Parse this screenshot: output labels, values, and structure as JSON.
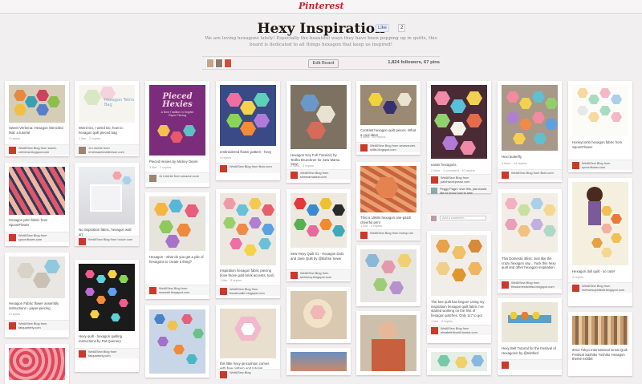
{
  "header": {
    "logo": "Pinterest"
  },
  "board": {
    "title": "Hexy Inspiration",
    "like": "Like",
    "like_count": "2",
    "description": "We are loving hexagons lately! Especially the beautiful ways they have been popping up in quilts, this board is dedicated to all things hexagon that keep us inspired!",
    "edit_label": "Edit Board",
    "stats": "1,824 followers, 67 pins"
  },
  "pins": [
    {
      "cap": "Sweet Verbena: Hexagon Stenciled Mat: a tutorial",
      "rp": "3 repins",
      "from": "WeAllSew Blog from sweet-verbena.blogspot.com"
    },
    {
      "cap": "Hexagon prim fabric from SpoonFlower",
      "rp": "",
      "from": "WeAllSew Blog from spoonflower.com"
    },
    {
      "cap": "Hexagon Fabric flower assembly instructions - paper-piecing",
      "rp": "3 repins",
      "from": "WeAllSew Blog from fatquarterly.com"
    },
    {
      "cap": "Weird Do, I weird Do; how to: hexagon quilt pieced bag",
      "rp": "1 like · 2 repins",
      "from": "Jo Leichte from reneesachmattenson.com"
    },
    {
      "cap": "No inspiration fabric, hexagon wall art",
      "rp": "",
      "from": "WeAllSew Blog from houzz.com"
    },
    {
      "cap": "Hexy quilt - hexagon quilting instructions by Pat Quenery",
      "rp": "",
      "from": "WeAllSew Blog from fatquarterly.com"
    },
    {
      "cap": "Pieced Hexies by Mickey Depre",
      "rp": "1 like · 2 repins",
      "from": "Jo Leichte from amazon.com"
    },
    {
      "cap": "Hexagon - what do you get a pile of hexagons to create a thing?",
      "rp": "",
      "from": "WeAllSew Blog from sewweb.blogspot.com"
    },
    {
      "cap": "embroidered flower pattern - hexy",
      "rp": "3 repins",
      "from": "WeAllSew Blog from flickr.com"
    },
    {
      "cap": "Inspiration hexagon fabric piecing (love those gold brick accents, too!)",
      "rp": "1 like · 3 repins",
      "from": "WeAllSew Blog from fionalmallie.blogspot.com"
    },
    {
      "cap": "this little hexy pincushion comes with free pattern and tutorial",
      "rp": "",
      "from": "WeAllSew Blog"
    },
    {
      "cap": "Hexagon Key Fob Tutorial | by Tedha Brueckner for Sew Mama Sew!",
      "rp": "2 likes · 3 repins",
      "from": "WeAllSew Blog from sewmamasew.com"
    },
    {
      "cap": "Sew Hexy Quilt 01 - Hexagon Dots and Jane Quilt by @Bohse Sewe",
      "rp": "",
      "from": "WeAllSew Blog from sewhexy.blogspot.com"
    },
    {
      "cap": "Displacement Activity: Sew hexy fabric - hexagon mug rug inspiration",
      "rp": "",
      "from": "WeAllSew Blog from charlottesewsland.blogspot.co.uk"
    },
    {
      "cap": "Hexy Sewer Rolex pattern from Amy Butler",
      "rp": "",
      "from": ""
    },
    {
      "cap": "Contrast hexagon quilt pieces. What a cool idea!",
      "rp": "3 likes · 10 repins",
      "from": "WeAllSew Blog from sewwonder-skills.blogspot.com"
    },
    {
      "cap": "This is 1960s hexagon one-patch cheerful print",
      "rp": "1 like · 4 repins",
      "from": "WeAllSew Blog from truecp.net"
    },
    {
      "cap": "Quilt with hexagon quilting",
      "rp": "",
      "from": ""
    },
    {
      "cap": "easier hexagons",
      "rp": "2 likes · 1 comment · 10 repins",
      "from": "WeAllSew Blog from patchworkposse.com"
    },
    {
      "cap": "Peggy Page I love this, just would like to know how to sew",
      "rp": "",
      "from": ""
    },
    {
      "cap": "The bee quilt has begun! Using my inspiration hexagon quilt fabric I've started working on the first of hexagon patches. Only 117 to go!",
      "rp": "1 like · 2 repins",
      "from": "WeAllSew Blog from elizabethflorelli.tumblr.com"
    },
    {
      "cap": "Hexi butterfly",
      "rp": "3 likes · 14 repins",
      "from": "WeAllSew Blog from flickr.com"
    },
    {
      "cap": "This Domestic Bliss: Just like the crazy hexagon say... Yuck this hexy quilt and other hexagon inspiration",
      "rp": "",
      "from": "WeAllSew Blog from thisdomesticbliss.blogspot.com"
    },
    {
      "cap": "Hexy Belt Tutorial for the Festival of Hexagons! by @Inkthird",
      "rp": "",
      "from": ""
    },
    {
      "cap": "Honeycomb hexagon fabric from SpoonFlower",
      "rp": "",
      "from": "WeAllSew Blog from spoonflower.com"
    },
    {
      "cap": "Hexagon doll quilt - so cute!",
      "rp": "2 repins",
      "from": "WeAllSew Blog from mehwesqxbitesfr.blogspot.com"
    },
    {
      "cap": "2012 Tokyo International Great Quilt Festival Sashiko Yoshiko Hexagon theme exhibit",
      "rp": "",
      "from": ""
    }
  ],
  "comment_placeholder": "Add a comment..."
}
